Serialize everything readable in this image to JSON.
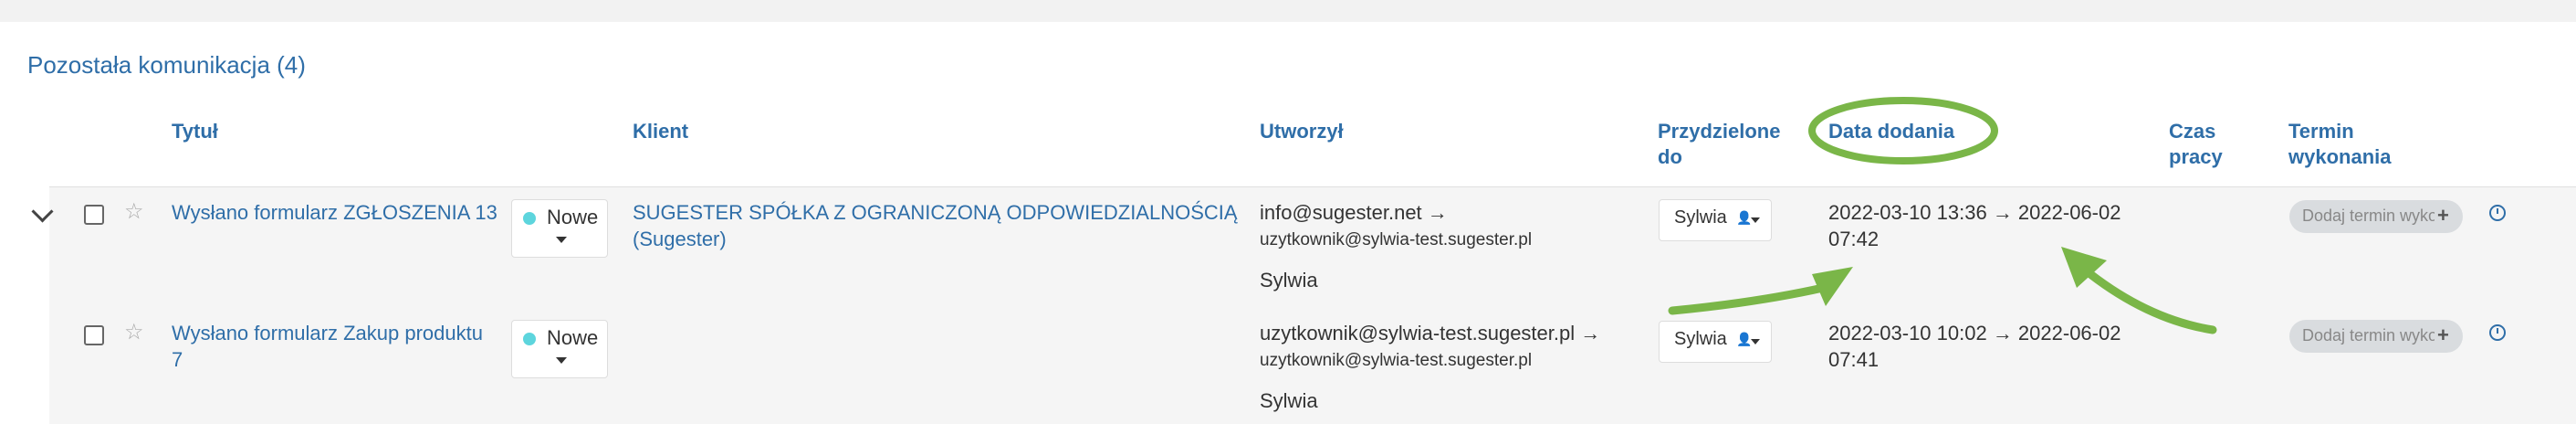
{
  "section": {
    "title": "Pozostała komunikacja (4)"
  },
  "columns": {
    "title": "Tytuł",
    "client": "Klient",
    "created_by": "Utworzył",
    "assigned_line1": "Przydzielone",
    "assigned_line2": "do",
    "date_added": "Data dodania",
    "work_time_line1": "Czas",
    "work_time_line2": "pracy",
    "deadline_line1": "Termin",
    "deadline_line2": "wykonania"
  },
  "rows": [
    {
      "title": "Wysłano formularz ZGŁOSZENIA 13",
      "status": "Nowe",
      "client_line1": "SUGESTER SPÓŁKA Z OGRANICZONĄ ODPOWIEDZIALNOŚCIĄ",
      "client_line2": "(Sugester)",
      "from": "info@sugester.net →",
      "to": "uzytkownik@sylwia-test.sugester.pl",
      "creator_name": "Sylwia",
      "assignee": "Sylwia",
      "date_line1": "2022-03-10 13:36 → 2022-06-02",
      "date_line2": "07:42",
      "deadline_button": "Dodaj termin wykonania"
    },
    {
      "title_line1": "Wysłano formularz Zakup produktu",
      "title_line2": "7",
      "status": "Nowe",
      "from": "uzytkownik@sylwia-test.sugester.pl →",
      "to": "uzytkownik@sylwia-test.sugester.pl",
      "creator_name": "Sylwia",
      "assignee": "Sylwia",
      "date_line1": "2022-03-10 10:02 → 2022-06-02",
      "date_line2": "07:41",
      "deadline_button": "Dodaj termin wykonania"
    }
  ],
  "colors": {
    "link": "#2f6ea8",
    "status_dot": "#5dd5dd",
    "annotation": "#7ab648"
  },
  "icons": [
    "chevron-down-icon",
    "star-icon",
    "user-icon",
    "plus-icon",
    "clock-icon"
  ]
}
